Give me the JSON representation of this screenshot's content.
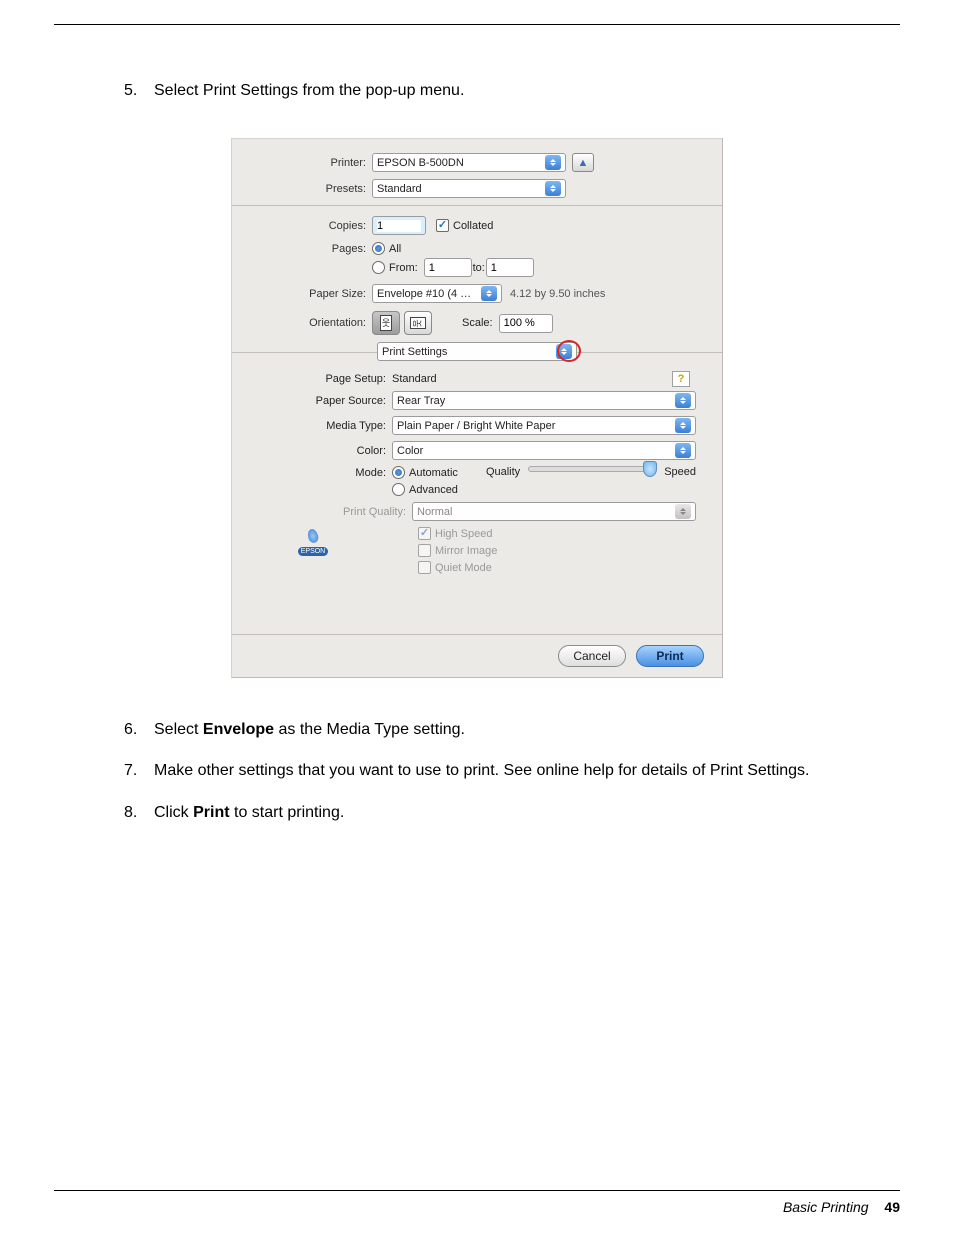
{
  "steps": [
    {
      "num": "5.",
      "html": "Select Print Settings from the pop-up menu."
    },
    {
      "num": "6.",
      "html": "Select <b>Envelope</b> as the Media Type setting."
    },
    {
      "num": "7.",
      "html": "Make other settings that you want to use to print. See online help for details of Print Settings."
    },
    {
      "num": "8.",
      "html": "Click <b>Print</b> to start printing."
    }
  ],
  "dlg": {
    "labels": {
      "printer": "Printer:",
      "presets": "Presets:",
      "copies": "Copies:",
      "collated": "Collated",
      "pages": "Pages:",
      "all": "All",
      "from": "From:",
      "to": "to:",
      "paperSize": "Paper Size:",
      "orientation": "Orientation:",
      "scale": "Scale:",
      "pageSetup": "Page Setup:",
      "paperSource": "Paper Source:",
      "mediaType": "Media Type:",
      "color": "Color:",
      "mode": "Mode:",
      "automatic": "Automatic",
      "advanced": "Advanced",
      "quality": "Quality",
      "speed": "Speed",
      "printQuality": "Print Quality:",
      "highSpeed": "High Speed",
      "mirrorImage": "Mirror Image",
      "quietMode": "Quiet Mode"
    },
    "values": {
      "printer": "EPSON B-500DN",
      "presets": "Standard",
      "copies": "1",
      "from": "1",
      "to": "1",
      "paperSize": "Envelope #10 (4 …",
      "paperSizeDim": "4.12 by 9.50 inches",
      "scale": "100 %",
      "sectionMenu": "Print Settings",
      "pageSetup": "Standard",
      "paperSource": "Rear Tray",
      "mediaType": "Plain Paper / Bright White Paper",
      "color": "Color",
      "printQuality": "Normal",
      "epsonTag": "EPSON"
    },
    "previewTriangle": "▲",
    "helpMark": "?",
    "buttons": {
      "cancel": "Cancel",
      "print": "Print"
    }
  },
  "footer": {
    "section": "Basic Printing",
    "page": "49"
  }
}
